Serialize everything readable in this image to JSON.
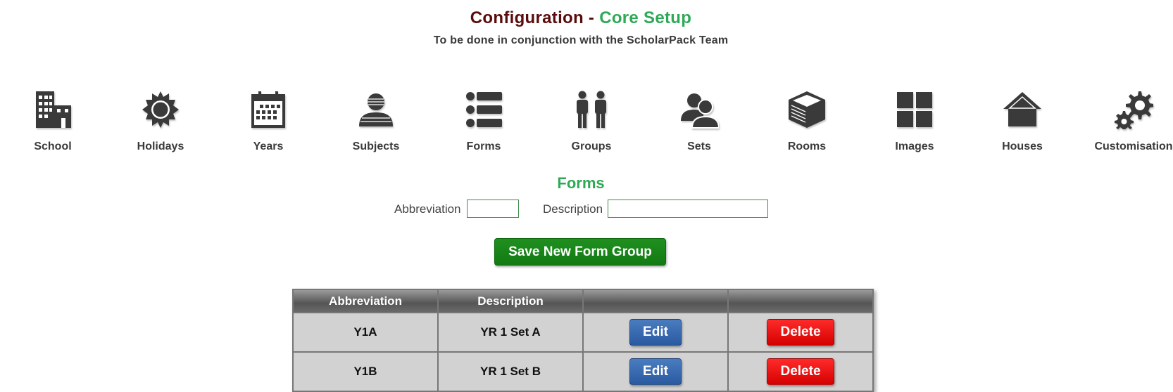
{
  "header": {
    "title_part1": "Configuration - ",
    "title_part2": "Core Setup",
    "subtitle": "To be done in conjunction with the ScholarPack Team",
    "colors": {
      "title_dark": "#5a0c0c",
      "title_accent": "#2eaa56"
    }
  },
  "nav": {
    "items": [
      {
        "label": "School",
        "icon": "building-icon"
      },
      {
        "label": "Holidays",
        "icon": "sun-icon"
      },
      {
        "label": "Years",
        "icon": "calendar-icon"
      },
      {
        "label": "Subjects",
        "icon": "person-icon"
      },
      {
        "label": "Forms",
        "icon": "list-icon"
      },
      {
        "label": "Groups",
        "icon": "people-pair-icon"
      },
      {
        "label": "Sets",
        "icon": "users-icon"
      },
      {
        "label": "Rooms",
        "icon": "cube-icon"
      },
      {
        "label": "Images",
        "icon": "grid-icon"
      },
      {
        "label": "Houses",
        "icon": "house-icon"
      },
      {
        "label": "Customisation",
        "icon": "gears-icon"
      }
    ]
  },
  "section": {
    "title": "Forms"
  },
  "form": {
    "abbreviation_label": "Abbreviation",
    "abbreviation_value": "",
    "description_label": "Description",
    "description_value": "",
    "save_label": "Save New Form Group",
    "save_color": "#1a851a"
  },
  "table": {
    "headers": [
      "Abbreviation",
      "Description",
      "",
      ""
    ],
    "rows": [
      {
        "abbreviation": "Y1A",
        "description": "YR 1 Set A",
        "edit": "Edit",
        "delete": "Delete"
      },
      {
        "abbreviation": "Y1B",
        "description": "YR 1 Set B",
        "edit": "Edit",
        "delete": "Delete"
      }
    ],
    "colors": {
      "edit": "#3566ad",
      "delete": "#ee0a0a"
    }
  }
}
